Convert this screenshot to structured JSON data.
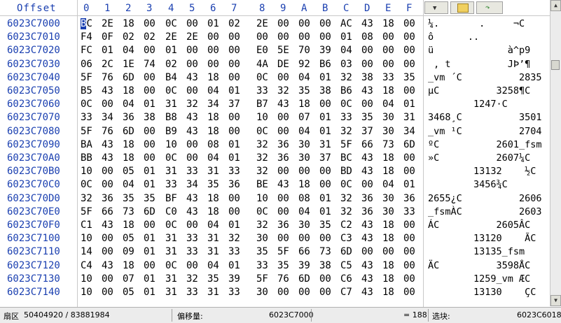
{
  "header": {
    "offset_label": "Offset",
    "columns": [
      "0",
      "1",
      "2",
      "3",
      "4",
      "5",
      "6",
      "7",
      "8",
      "9",
      "A",
      "B",
      "C",
      "D",
      "E",
      "F"
    ]
  },
  "rows": [
    {
      "offset": "6023C7000",
      "bytes": [
        "BC",
        "2E",
        "18",
        "00",
        "0C",
        "00",
        "01",
        "02",
        "2E",
        "00",
        "00",
        "00",
        "AC",
        "43",
        "18",
        "00"
      ],
      "ascii": "¼.       .     ¬C"
    },
    {
      "offset": "6023C7010",
      "bytes": [
        "F4",
        "0F",
        "02",
        "02",
        "2E",
        "2E",
        "00",
        "00",
        "00",
        "00",
        "00",
        "00",
        "01",
        "08",
        "00",
        "00"
      ],
      "ascii": "ô      .."
    },
    {
      "offset": "6023C7020",
      "bytes": [
        "FC",
        "01",
        "04",
        "00",
        "01",
        "00",
        "00",
        "00",
        "E0",
        "5E",
        "70",
        "39",
        "04",
        "00",
        "00",
        "00"
      ],
      "ascii": "ü             à^p9"
    },
    {
      "offset": "6023C7030",
      "bytes": [
        "06",
        "2C",
        "1E",
        "74",
        "02",
        "00",
        "00",
        "00",
        "4A",
        "DE",
        "92",
        "B6",
        "03",
        "00",
        "00",
        "00"
      ],
      "ascii": " , t          JÞ’¶"
    },
    {
      "offset": "6023C7040",
      "bytes": [
        "5F",
        "76",
        "6D",
        "00",
        "B4",
        "43",
        "18",
        "00",
        "0C",
        "00",
        "04",
        "01",
        "32",
        "38",
        "33",
        "35"
      ],
      "ascii": "_vm ´C          2835"
    },
    {
      "offset": "6023C7050",
      "bytes": [
        "B5",
        "43",
        "18",
        "00",
        "0C",
        "00",
        "04",
        "01",
        "33",
        "32",
        "35",
        "38",
        "B6",
        "43",
        "18",
        "00"
      ],
      "ascii": "µC          3258¶C"
    },
    {
      "offset": "6023C7060",
      "bytes": [
        "0C",
        "00",
        "04",
        "01",
        "31",
        "32",
        "34",
        "37",
        "B7",
        "43",
        "18",
        "00",
        "0C",
        "00",
        "04",
        "01"
      ],
      "ascii": "        1247·C"
    },
    {
      "offset": "6023C7070",
      "bytes": [
        "33",
        "34",
        "36",
        "38",
        "B8",
        "43",
        "18",
        "00",
        "10",
        "00",
        "07",
        "01",
        "33",
        "35",
        "30",
        "31"
      ],
      "ascii": "3468¸C          3501"
    },
    {
      "offset": "6023C7080",
      "bytes": [
        "5F",
        "76",
        "6D",
        "00",
        "B9",
        "43",
        "18",
        "00",
        "0C",
        "00",
        "04",
        "01",
        "32",
        "37",
        "30",
        "34"
      ],
      "ascii": "_vm ¹C          2704"
    },
    {
      "offset": "6023C7090",
      "bytes": [
        "BA",
        "43",
        "18",
        "00",
        "10",
        "00",
        "08",
        "01",
        "32",
        "36",
        "30",
        "31",
        "5F",
        "66",
        "73",
        "6D"
      ],
      "ascii": "ºC          2601_fsm"
    },
    {
      "offset": "6023C70A0",
      "bytes": [
        "BB",
        "43",
        "18",
        "00",
        "0C",
        "00",
        "04",
        "01",
        "32",
        "36",
        "30",
        "37",
        "BC",
        "43",
        "18",
        "00"
      ],
      "ascii": "»C          2607¼C"
    },
    {
      "offset": "6023C70B0",
      "bytes": [
        "10",
        "00",
        "05",
        "01",
        "31",
        "33",
        "31",
        "33",
        "32",
        "00",
        "00",
        "00",
        "BD",
        "43",
        "18",
        "00"
      ],
      "ascii": "        13132    ½C"
    },
    {
      "offset": "6023C70C0",
      "bytes": [
        "0C",
        "00",
        "04",
        "01",
        "33",
        "34",
        "35",
        "36",
        "BE",
        "43",
        "18",
        "00",
        "0C",
        "00",
        "04",
        "01"
      ],
      "ascii": "        3456¾C"
    },
    {
      "offset": "6023C70D0",
      "bytes": [
        "32",
        "36",
        "35",
        "35",
        "BF",
        "43",
        "18",
        "00",
        "10",
        "00",
        "08",
        "01",
        "32",
        "36",
        "30",
        "36"
      ],
      "ascii": "2655¿C          2606"
    },
    {
      "offset": "6023C70E0",
      "bytes": [
        "5F",
        "66",
        "73",
        "6D",
        "C0",
        "43",
        "18",
        "00",
        "0C",
        "00",
        "04",
        "01",
        "32",
        "36",
        "30",
        "33"
      ],
      "ascii": "_fsmÀC          2603"
    },
    {
      "offset": "6023C70F0",
      "bytes": [
        "C1",
        "43",
        "18",
        "00",
        "0C",
        "00",
        "04",
        "01",
        "32",
        "36",
        "30",
        "35",
        "C2",
        "43",
        "18",
        "00"
      ],
      "ascii": "ÁC          2605ÂC"
    },
    {
      "offset": "6023C7100",
      "bytes": [
        "10",
        "00",
        "05",
        "01",
        "31",
        "33",
        "31",
        "32",
        "30",
        "00",
        "00",
        "00",
        "C3",
        "43",
        "18",
        "00"
      ],
      "ascii": "        13120    ÃC"
    },
    {
      "offset": "6023C7110",
      "bytes": [
        "14",
        "00",
        "09",
        "01",
        "31",
        "33",
        "31",
        "33",
        "35",
        "5F",
        "66",
        "73",
        "6D",
        "00",
        "00",
        "00"
      ],
      "ascii": "        13135_fsm"
    },
    {
      "offset": "6023C7120",
      "bytes": [
        "C4",
        "43",
        "18",
        "00",
        "0C",
        "00",
        "04",
        "01",
        "33",
        "35",
        "39",
        "38",
        "C5",
        "43",
        "18",
        "00"
      ],
      "ascii": "ÄC          3598ÅC"
    },
    {
      "offset": "6023C7130",
      "bytes": [
        "10",
        "00",
        "07",
        "01",
        "31",
        "32",
        "35",
        "39",
        "5F",
        "76",
        "6D",
        "00",
        "C6",
        "43",
        "18",
        "00"
      ],
      "ascii": "        1259_vm ÆC"
    },
    {
      "offset": "6023C7140",
      "bytes": [
        "10",
        "00",
        "05",
        "01",
        "31",
        "33",
        "31",
        "33",
        "30",
        "00",
        "00",
        "00",
        "C7",
        "43",
        "18",
        "00"
      ],
      "ascii": "        13130    ÇC"
    }
  ],
  "status": {
    "sector_label": "扇区",
    "sector_value": "50404920 / 83881984",
    "offset_label": "偏移量:",
    "offset_value": "6023C7000",
    "eq_value": "= 188",
    "select_label": "选块:",
    "select_value": "6023C6018 -"
  },
  "colors": {
    "accent": "#1a3fb0",
    "cursor": "#1a3fb0"
  }
}
